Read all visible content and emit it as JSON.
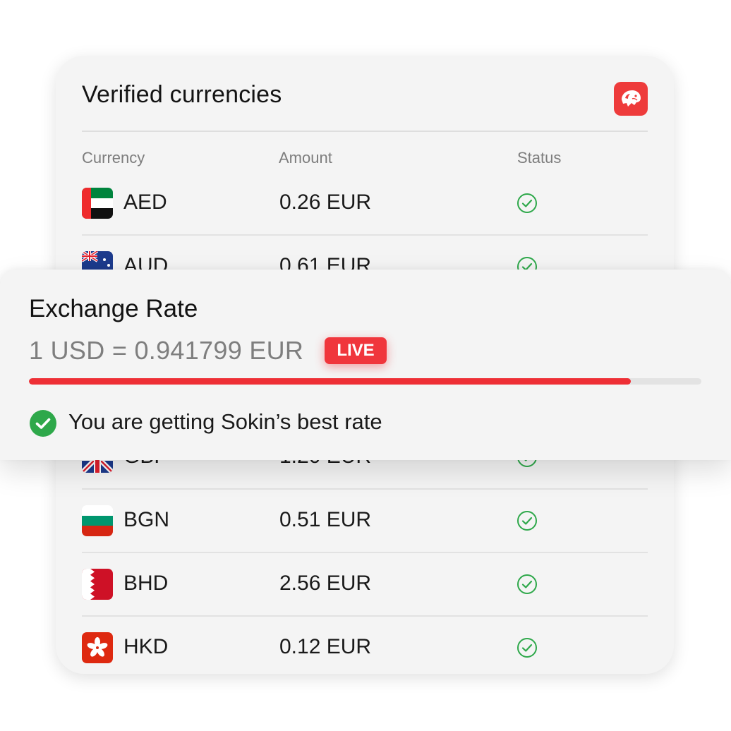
{
  "card": {
    "title": "Verified currencies",
    "logo_icon": "sokin-lion-logo-icon",
    "columns": {
      "currency": "Currency",
      "amount": "Amount",
      "status": "Status"
    },
    "rows": [
      {
        "code": "AED",
        "amount": "0.26 EUR",
        "flag": "uae-flag-icon",
        "status": "verified-check-icon"
      },
      {
        "code": "AUD",
        "amount": "0.61 EUR",
        "flag": "australia-flag-icon",
        "status": "verified-check-icon"
      },
      {
        "code": "GBP",
        "amount": "1.20 EUR",
        "flag": "uk-flag-icon",
        "status": "verified-check-icon"
      },
      {
        "code": "BGN",
        "amount": "0.51 EUR",
        "flag": "bulgaria-flag-icon",
        "status": "verified-check-icon"
      },
      {
        "code": "BHD",
        "amount": "2.56 EUR",
        "flag": "bahrain-flag-icon",
        "status": "verified-check-icon"
      },
      {
        "code": "HKD",
        "amount": "0.12 EUR",
        "flag": "hong-kong-flag-icon",
        "status": "verified-check-icon"
      }
    ]
  },
  "exchange": {
    "title": "Exchange Rate",
    "rate": "1 USD = 0.941799 EUR",
    "badge": "LIVE",
    "progress": 0.895,
    "best_rate_text": "You are getting Sokin’s best rate",
    "best_rate_icon": "check-circle-icon"
  },
  "colors": {
    "accent_red": "#ee2f35",
    "check_green": "#2ea84a",
    "card_bg": "#f4f4f4"
  }
}
